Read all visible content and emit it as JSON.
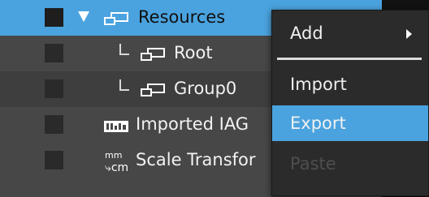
{
  "tree": {
    "items": [
      {
        "label": "Resources",
        "icon": "resource-node-icon",
        "expanded": true,
        "selected": true
      },
      {
        "label": "Root",
        "icon": "resource-node-icon",
        "level": 1
      },
      {
        "label": "Group0",
        "icon": "resource-node-icon",
        "level": 1
      },
      {
        "label": "Imported IAG",
        "icon": "imported-iag-icon"
      },
      {
        "label": "Scale Transfor",
        "icon": "scale-transform-icon"
      }
    ]
  },
  "context_menu": {
    "items": [
      {
        "label": "Add",
        "has_submenu": true
      },
      {
        "label": "Import"
      },
      {
        "label": "Export",
        "highlighted": true
      },
      {
        "label": "Paste",
        "disabled": true
      }
    ]
  },
  "colors": {
    "selection": "#4aa3df",
    "panel_background": "#474747",
    "menu_background": "#2b2b2b",
    "disabled_text": "#4e4e4e"
  }
}
